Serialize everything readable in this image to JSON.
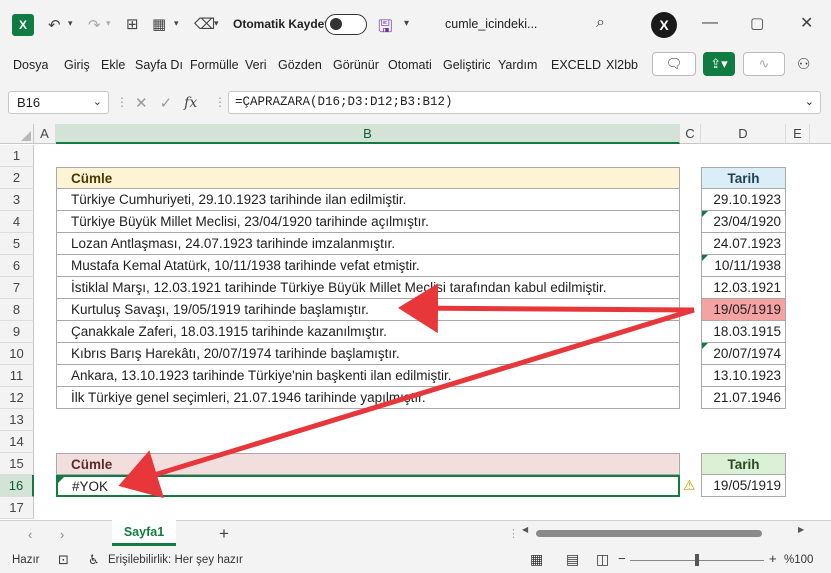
{
  "titlebar": {
    "autosave_label": "Otomatik Kaydet",
    "filename": "cumle_icindeki...",
    "xl_badge": "X"
  },
  "menu": {
    "items": [
      "Dosya",
      "Giriş",
      "Ekle",
      "Sayfa Dı",
      "Formülle",
      "Veri",
      "Gözden",
      "Görünür",
      "Otomati",
      "Geliştiric",
      "Yardım",
      "EXCELD",
      "Xl2bb"
    ]
  },
  "formula_bar": {
    "name_box": "B16",
    "fx": "fx",
    "formula": "=ÇAPRAZARA(D16;D3:D12;B3:B12)"
  },
  "columns": [
    "A",
    "B",
    "C",
    "D",
    "E"
  ],
  "rows": [
    "1",
    "2",
    "3",
    "4",
    "5",
    "6",
    "7",
    "8",
    "9",
    "10",
    "11",
    "12",
    "13",
    "14",
    "15",
    "16",
    "17"
  ],
  "table1": {
    "header_b": "Cümle",
    "header_d": "Tarih",
    "rows": [
      {
        "b": "Türkiye Cumhuriyeti, 29.10.1923 tarihinde ilan edilmiştir.",
        "d": "29.10.1923"
      },
      {
        "b": "Türkiye Büyük Millet Meclisi, 23/04/1920 tarihinde açılmıştır.",
        "d": "23/04/1920"
      },
      {
        "b": "Lozan Antlaşması, 24.07.1923 tarihinde imzalanmıştır.",
        "d": "24.07.1923"
      },
      {
        "b": "Mustafa Kemal Atatürk, 10/11/1938 tarihinde vefat etmiştir.",
        "d": "10/11/1938"
      },
      {
        "b": "İstiklal Marşı, 12.03.1921 tarihinde Türkiye Büyük Millet Meclisi tarafından kabul edilmiştir.",
        "d": "12.03.1921"
      },
      {
        "b": "Kurtuluş Savaşı, 19/05/1919 tarihinde başlamıştır.",
        "d": "19/05/1919"
      },
      {
        "b": "Çanakkale Zaferi, 18.03.1915 tarihinde kazanılmıştır.",
        "d": "18.03.1915"
      },
      {
        "b": "Kıbrıs Barış Harekâtı, 20/07/1974 tarihinde başlamıştır.",
        "d": "20/07/1974"
      },
      {
        "b": "Ankara, 13.10.1923 tarihinde Türkiye'nin başkenti ilan edilmiştir.",
        "d": "13.10.1923"
      },
      {
        "b": "İlk Türkiye genel seçimleri, 21.07.1946 tarihinde yapılmıştır.",
        "d": "21.07.1946"
      }
    ]
  },
  "table2": {
    "header_b": "Cümle",
    "header_d": "Tarih",
    "result_b": "#YOK",
    "value_d": "19/05/1919"
  },
  "sheet_tab": "Sayfa1",
  "add_sheet": "+",
  "status": {
    "ready": "Hazır",
    "accessibility": "Erişilebilirlik: Her şey hazır",
    "zoom": "%100"
  },
  "colors": {
    "accent": "#107c41",
    "highlight": "#f4a2a2",
    "arrow": "#e8373b"
  }
}
